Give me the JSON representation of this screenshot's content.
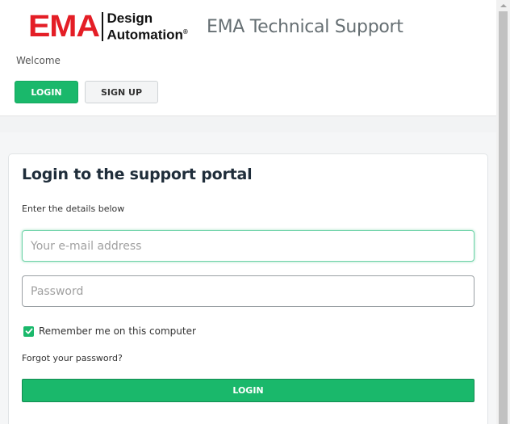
{
  "header": {
    "logo": {
      "mark": "EMA",
      "line1": "Design",
      "line2": "Automation",
      "registered": "®"
    },
    "site_title": "EMA Technical Support",
    "welcome": "Welcome",
    "login_label": "LOGIN",
    "signup_label": "SIGN UP"
  },
  "login_card": {
    "title": "Login to the support portal",
    "subtitle": "Enter the details below",
    "email_placeholder": "Your e-mail address",
    "email_value": "",
    "password_placeholder": "Password",
    "password_value": "",
    "remember_label": "Remember me on this computer",
    "remember_checked": true,
    "forgot_label": "Forgot your password?",
    "submit_label": "LOGIN"
  },
  "colors": {
    "brand_red": "#e41e26",
    "accent_green": "#1ab86b",
    "title_gray": "#666f73"
  },
  "icons": {
    "checkbox": "check-icon",
    "scroll_up": "chevron-up-icon"
  }
}
